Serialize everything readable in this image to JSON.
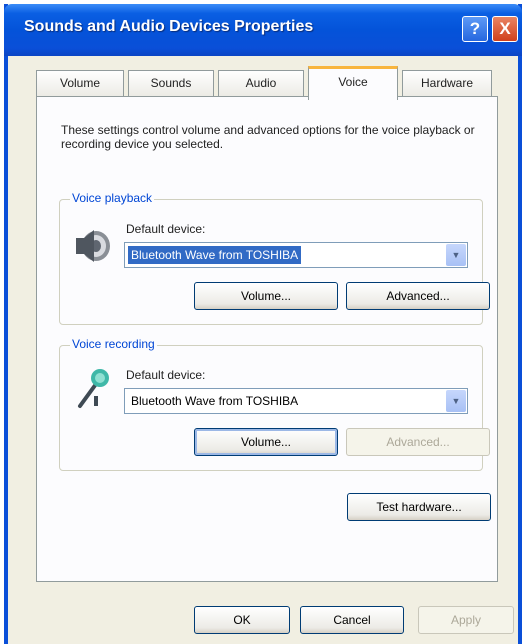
{
  "window": {
    "title": "Sounds and Audio Devices Properties"
  },
  "titlebar_buttons": {
    "help": "?",
    "close": "X"
  },
  "tabs": [
    {
      "label": "Volume",
      "active": false
    },
    {
      "label": "Sounds",
      "active": false
    },
    {
      "label": "Audio",
      "active": false
    },
    {
      "label": "Voice",
      "active": true
    },
    {
      "label": "Hardware",
      "active": false
    }
  ],
  "description": "These settings control volume and advanced options for the voice playback or recording device you selected.",
  "playback": {
    "group_label": "Voice playback",
    "device_label": "Default device:",
    "device_value": "Bluetooth Wave from TOSHIBA",
    "volume_button": "Volume...",
    "advanced_button": "Advanced..."
  },
  "recording": {
    "group_label": "Voice recording",
    "device_label": "Default device:",
    "device_value": "Bluetooth Wave from TOSHIBA",
    "volume_button": "Volume...",
    "advanced_button": "Advanced..."
  },
  "test_hardware_button": "Test hardware...",
  "footer": {
    "ok": "OK",
    "cancel": "Cancel",
    "apply": "Apply"
  },
  "icons": {
    "speaker": "speaker-icon",
    "microphone": "microphone-icon",
    "dropdown": "chevron-down-icon"
  },
  "colors": {
    "title_bar": "#0a4fd8",
    "selection": "#316ac5",
    "group_label": "#0046d5",
    "active_tab_accent": "#f8b53e"
  }
}
